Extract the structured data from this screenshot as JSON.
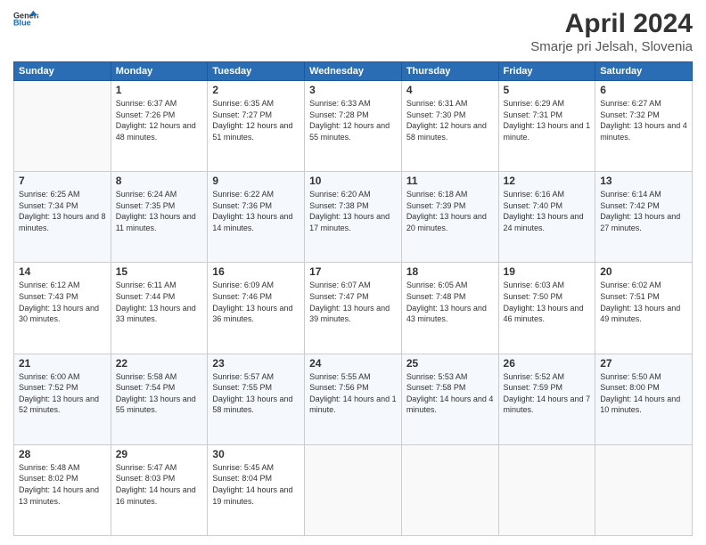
{
  "header": {
    "logo_general": "General",
    "logo_blue": "Blue",
    "month_title": "April 2024",
    "location": "Smarje pri Jelsah, Slovenia"
  },
  "weekdays": [
    "Sunday",
    "Monday",
    "Tuesday",
    "Wednesday",
    "Thursday",
    "Friday",
    "Saturday"
  ],
  "weeks": [
    [
      {
        "day": "",
        "sunrise": "",
        "sunset": "",
        "daylight": ""
      },
      {
        "day": "1",
        "sunrise": "Sunrise: 6:37 AM",
        "sunset": "Sunset: 7:26 PM",
        "daylight": "Daylight: 12 hours and 48 minutes."
      },
      {
        "day": "2",
        "sunrise": "Sunrise: 6:35 AM",
        "sunset": "Sunset: 7:27 PM",
        "daylight": "Daylight: 12 hours and 51 minutes."
      },
      {
        "day": "3",
        "sunrise": "Sunrise: 6:33 AM",
        "sunset": "Sunset: 7:28 PM",
        "daylight": "Daylight: 12 hours and 55 minutes."
      },
      {
        "day": "4",
        "sunrise": "Sunrise: 6:31 AM",
        "sunset": "Sunset: 7:30 PM",
        "daylight": "Daylight: 12 hours and 58 minutes."
      },
      {
        "day": "5",
        "sunrise": "Sunrise: 6:29 AM",
        "sunset": "Sunset: 7:31 PM",
        "daylight": "Daylight: 13 hours and 1 minute."
      },
      {
        "day": "6",
        "sunrise": "Sunrise: 6:27 AM",
        "sunset": "Sunset: 7:32 PM",
        "daylight": "Daylight: 13 hours and 4 minutes."
      }
    ],
    [
      {
        "day": "7",
        "sunrise": "Sunrise: 6:25 AM",
        "sunset": "Sunset: 7:34 PM",
        "daylight": "Daylight: 13 hours and 8 minutes."
      },
      {
        "day": "8",
        "sunrise": "Sunrise: 6:24 AM",
        "sunset": "Sunset: 7:35 PM",
        "daylight": "Daylight: 13 hours and 11 minutes."
      },
      {
        "day": "9",
        "sunrise": "Sunrise: 6:22 AM",
        "sunset": "Sunset: 7:36 PM",
        "daylight": "Daylight: 13 hours and 14 minutes."
      },
      {
        "day": "10",
        "sunrise": "Sunrise: 6:20 AM",
        "sunset": "Sunset: 7:38 PM",
        "daylight": "Daylight: 13 hours and 17 minutes."
      },
      {
        "day": "11",
        "sunrise": "Sunrise: 6:18 AM",
        "sunset": "Sunset: 7:39 PM",
        "daylight": "Daylight: 13 hours and 20 minutes."
      },
      {
        "day": "12",
        "sunrise": "Sunrise: 6:16 AM",
        "sunset": "Sunset: 7:40 PM",
        "daylight": "Daylight: 13 hours and 24 minutes."
      },
      {
        "day": "13",
        "sunrise": "Sunrise: 6:14 AM",
        "sunset": "Sunset: 7:42 PM",
        "daylight": "Daylight: 13 hours and 27 minutes."
      }
    ],
    [
      {
        "day": "14",
        "sunrise": "Sunrise: 6:12 AM",
        "sunset": "Sunset: 7:43 PM",
        "daylight": "Daylight: 13 hours and 30 minutes."
      },
      {
        "day": "15",
        "sunrise": "Sunrise: 6:11 AM",
        "sunset": "Sunset: 7:44 PM",
        "daylight": "Daylight: 13 hours and 33 minutes."
      },
      {
        "day": "16",
        "sunrise": "Sunrise: 6:09 AM",
        "sunset": "Sunset: 7:46 PM",
        "daylight": "Daylight: 13 hours and 36 minutes."
      },
      {
        "day": "17",
        "sunrise": "Sunrise: 6:07 AM",
        "sunset": "Sunset: 7:47 PM",
        "daylight": "Daylight: 13 hours and 39 minutes."
      },
      {
        "day": "18",
        "sunrise": "Sunrise: 6:05 AM",
        "sunset": "Sunset: 7:48 PM",
        "daylight": "Daylight: 13 hours and 43 minutes."
      },
      {
        "day": "19",
        "sunrise": "Sunrise: 6:03 AM",
        "sunset": "Sunset: 7:50 PM",
        "daylight": "Daylight: 13 hours and 46 minutes."
      },
      {
        "day": "20",
        "sunrise": "Sunrise: 6:02 AM",
        "sunset": "Sunset: 7:51 PM",
        "daylight": "Daylight: 13 hours and 49 minutes."
      }
    ],
    [
      {
        "day": "21",
        "sunrise": "Sunrise: 6:00 AM",
        "sunset": "Sunset: 7:52 PM",
        "daylight": "Daylight: 13 hours and 52 minutes."
      },
      {
        "day": "22",
        "sunrise": "Sunrise: 5:58 AM",
        "sunset": "Sunset: 7:54 PM",
        "daylight": "Daylight: 13 hours and 55 minutes."
      },
      {
        "day": "23",
        "sunrise": "Sunrise: 5:57 AM",
        "sunset": "Sunset: 7:55 PM",
        "daylight": "Daylight: 13 hours and 58 minutes."
      },
      {
        "day": "24",
        "sunrise": "Sunrise: 5:55 AM",
        "sunset": "Sunset: 7:56 PM",
        "daylight": "Daylight: 14 hours and 1 minute."
      },
      {
        "day": "25",
        "sunrise": "Sunrise: 5:53 AM",
        "sunset": "Sunset: 7:58 PM",
        "daylight": "Daylight: 14 hours and 4 minutes."
      },
      {
        "day": "26",
        "sunrise": "Sunrise: 5:52 AM",
        "sunset": "Sunset: 7:59 PM",
        "daylight": "Daylight: 14 hours and 7 minutes."
      },
      {
        "day": "27",
        "sunrise": "Sunrise: 5:50 AM",
        "sunset": "Sunset: 8:00 PM",
        "daylight": "Daylight: 14 hours and 10 minutes."
      }
    ],
    [
      {
        "day": "28",
        "sunrise": "Sunrise: 5:48 AM",
        "sunset": "Sunset: 8:02 PM",
        "daylight": "Daylight: 14 hours and 13 minutes."
      },
      {
        "day": "29",
        "sunrise": "Sunrise: 5:47 AM",
        "sunset": "Sunset: 8:03 PM",
        "daylight": "Daylight: 14 hours and 16 minutes."
      },
      {
        "day": "30",
        "sunrise": "Sunrise: 5:45 AM",
        "sunset": "Sunset: 8:04 PM",
        "daylight": "Daylight: 14 hours and 19 minutes."
      },
      {
        "day": "",
        "sunrise": "",
        "sunset": "",
        "daylight": ""
      },
      {
        "day": "",
        "sunrise": "",
        "sunset": "",
        "daylight": ""
      },
      {
        "day": "",
        "sunrise": "",
        "sunset": "",
        "daylight": ""
      },
      {
        "day": "",
        "sunrise": "",
        "sunset": "",
        "daylight": ""
      }
    ]
  ]
}
